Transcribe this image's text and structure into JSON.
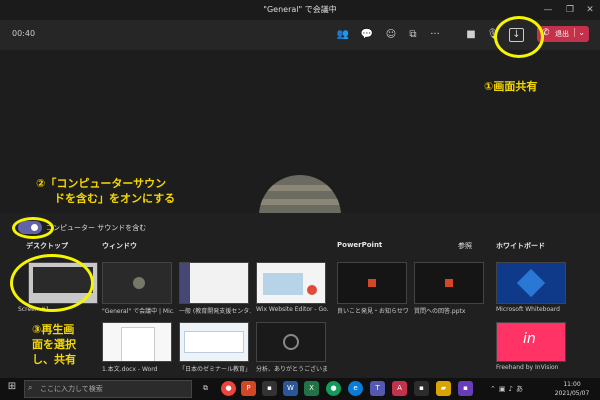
{
  "window": {
    "title": "\"General\" で会議中"
  },
  "toolbar": {
    "timer": "00:40",
    "leave_label": "退出"
  },
  "share_panel": {
    "toggle_label": "コンピューター サウンドを含む",
    "sections": {
      "desktop": "デスクトップ",
      "window": "ウィンドウ",
      "powerpoint": "PowerPoint",
      "browse": "参照",
      "whiteboard": "ホワイトボード"
    },
    "desktop_items": [
      {
        "caption": "Screen #1"
      }
    ],
    "windows_row1": [
      {
        "caption": "\"General\" で会議中 | Mic..."
      },
      {
        "caption": "一般 (教育開発支援センタ..."
      },
      {
        "caption": "Wix Website Editor - Go..."
      }
    ],
    "windows_row2": [
      {
        "caption": "1.本文.docx - Word"
      },
      {
        "caption": "「日本のゼミナール教育」..."
      },
      {
        "caption": "分析、ありがとうございま..."
      }
    ],
    "powerpoint_items": [
      {
        "caption": "良いこと発見・お知らせワ..."
      },
      {
        "caption": "質問への回答.pptx"
      }
    ],
    "whiteboard_items": [
      {
        "caption": "Microsoft Whiteboard"
      },
      {
        "caption": "Freehand by InVision"
      }
    ]
  },
  "annotations": {
    "a1": "①画面共有",
    "a2_line1": "②「コンピューターサウン",
    "a2_line2": "ドを含む」をオンにする",
    "a3_line1": "③再生画",
    "a3_line2": "面を選択",
    "a3_line3": "し、共有"
  },
  "taskbar": {
    "search_placeholder": "ここに入力して検索",
    "time": "11:00",
    "date": "2021/05/07"
  },
  "colors": {
    "accent": "#6264a7",
    "leave": "#c4314b",
    "annotation": "#f5f500"
  }
}
